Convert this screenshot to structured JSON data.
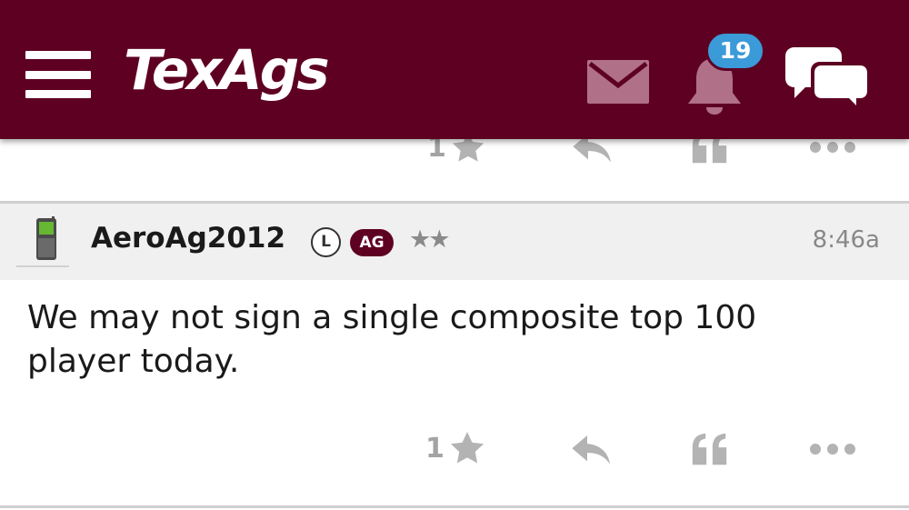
{
  "app": {
    "logo_text": "TexAgs",
    "brand_color": "#5e0022",
    "badge_color": "#3b9ad8"
  },
  "header": {
    "menu_icon": "hamburger-icon",
    "mail_icon": "envelope-icon",
    "notifications_icon": "bell-icon",
    "notifications_count": "19",
    "chat_icon": "chat-bubbles-icon"
  },
  "previous_post": {
    "actions": {
      "star_count": "1",
      "star_icon": "star-icon",
      "reply_icon": "reply-icon",
      "quote_icon": "quote-icon",
      "more_icon": "more-icon"
    }
  },
  "post": {
    "avatar_icon": "phone-avatar-icon",
    "username": "AeroAg2012",
    "badges": {
      "l": "L",
      "ag": "AG"
    },
    "rating_stars": "★★",
    "time": "8:46a",
    "body": "We may not sign a single composite top 100 player today.",
    "actions": {
      "star_count": "1",
      "star_icon": "star-icon",
      "reply_icon": "reply-icon",
      "quote_icon": "quote-icon",
      "more_icon": "more-icon"
    }
  }
}
